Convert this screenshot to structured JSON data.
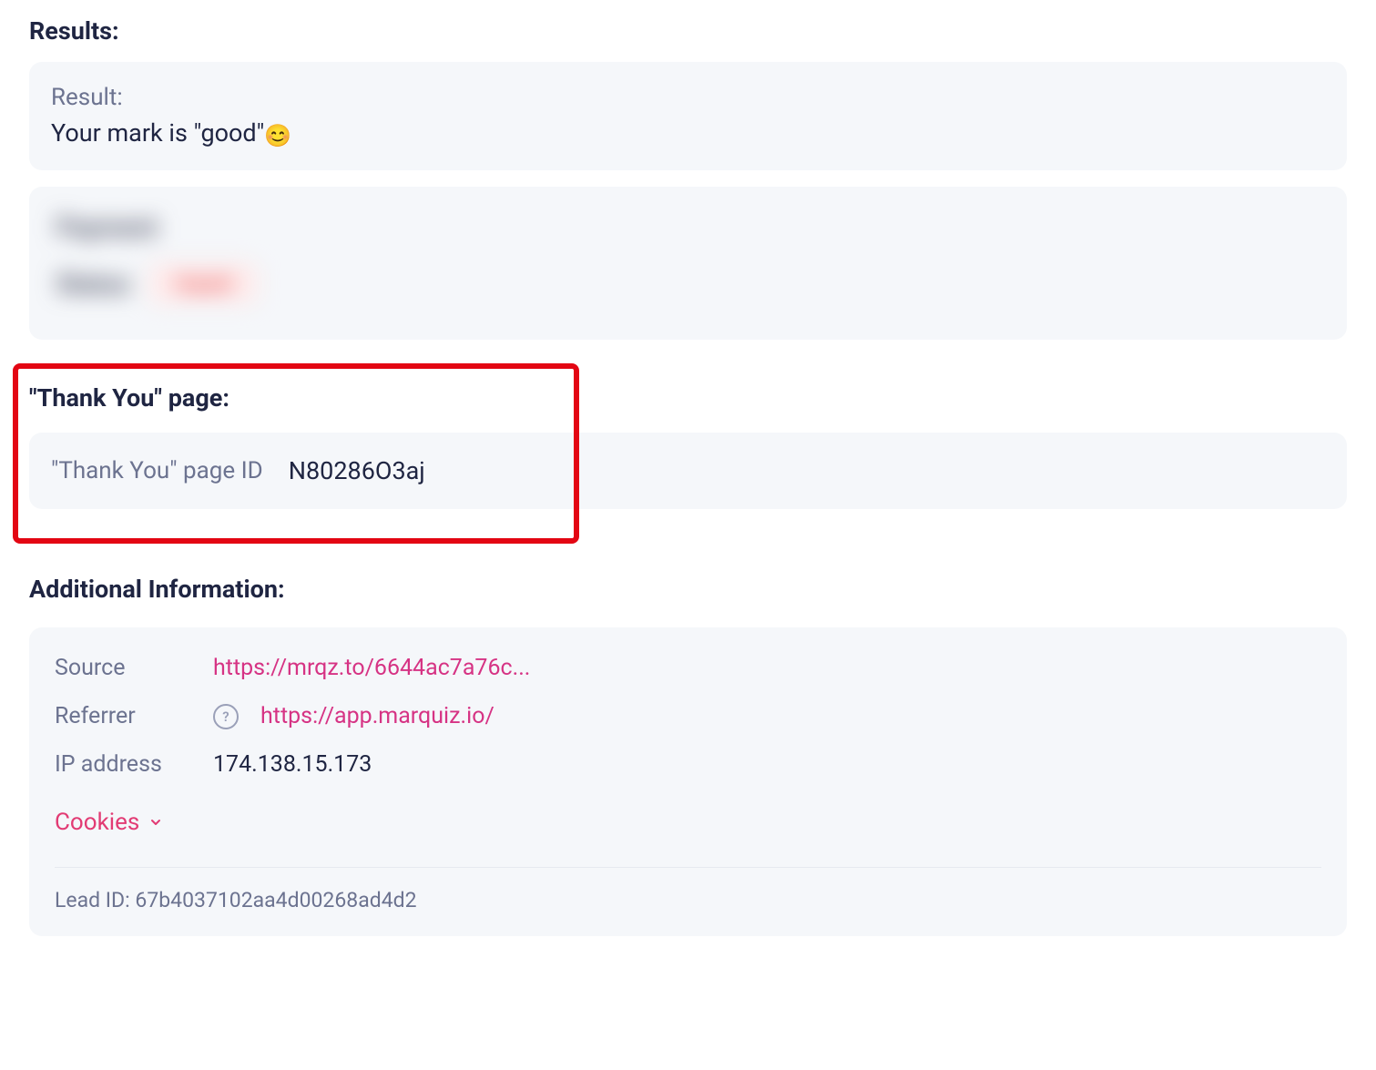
{
  "results": {
    "heading": "Results:",
    "result_label": "Result:",
    "result_text": "Your mark is \"good\"",
    "result_emoji": "😊"
  },
  "payment_blurred": {
    "title": "Payment",
    "status_label": "Status",
    "status_value": "Unpaid"
  },
  "thank_you": {
    "heading": "\"Thank You\" page:",
    "id_label": "\"Thank You\" page ID",
    "id_value": "N80286O3aj"
  },
  "additional": {
    "heading": "Additional Information:",
    "source": {
      "label": "Source",
      "url_display": "https://mrqz.to/6644ac7a76c..."
    },
    "referrer": {
      "label": "Referrer",
      "url_display": "https://app.marquiz.io/"
    },
    "ip": {
      "label": "IP address",
      "value": "174.138.15.173"
    },
    "cookies": {
      "label": "Cookies"
    },
    "lead_id": {
      "prefix": "Lead ID: ",
      "value": "67b4037102aa4d00268ad4d2"
    }
  }
}
